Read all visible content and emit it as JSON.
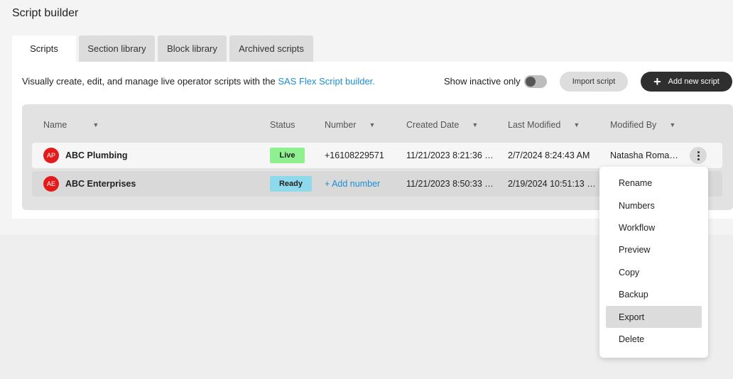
{
  "page": {
    "title": "Script builder"
  },
  "tabs": [
    {
      "label": "Scripts",
      "active": true
    },
    {
      "label": "Section library",
      "active": false
    },
    {
      "label": "Block library",
      "active": false
    },
    {
      "label": "Archived scripts",
      "active": false
    }
  ],
  "toolbar": {
    "description_prefix": "Visually create, edit, and manage live operator scripts with the ",
    "description_link": "SAS Flex Script builder.",
    "show_inactive_label": "Show inactive only",
    "show_inactive_on": false,
    "import_label": "Import script",
    "add_label": "Add new script"
  },
  "table": {
    "columns": {
      "name": "Name",
      "status": "Status",
      "number": "Number",
      "created": "Created Date",
      "modified": "Last Modified",
      "modified_by": "Modified By"
    },
    "rows": [
      {
        "initials": "AP",
        "name": "ABC Plumbing",
        "status": "Live",
        "number": "+16108229571",
        "created": "11/21/2023 8:21:36 …",
        "modified": "2/7/2024 8:24:43 AM",
        "modified_by": "Natasha Roma…"
      },
      {
        "initials": "AE",
        "name": "ABC Enterprises",
        "status": "Ready",
        "number": "+ Add number",
        "created": "11/21/2023 8:50:33 …",
        "modified": "2/19/2024 10:51:13 …",
        "modified_by": ""
      }
    ]
  },
  "context_menu": {
    "items": [
      "Rename",
      "Numbers",
      "Workflow",
      "Preview",
      "Copy",
      "Backup",
      "Export",
      "Delete"
    ],
    "highlighted": "Export"
  },
  "colors": {
    "accent_link": "#1a8fd6",
    "live_badge": "#8ef08e",
    "ready_badge": "#8fd9ec",
    "avatar": "#e31b1b",
    "primary_button": "#2f2f2f"
  }
}
